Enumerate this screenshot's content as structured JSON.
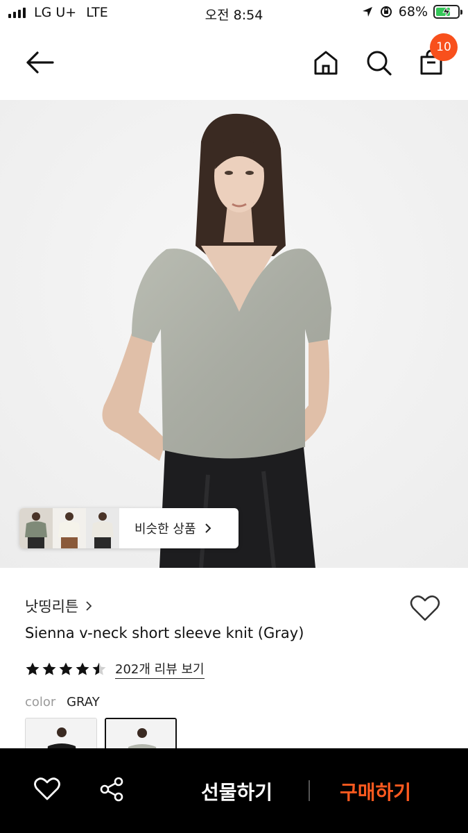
{
  "status_bar": {
    "carrier": "LG U+",
    "network": "LTE",
    "time": "오전 8:54",
    "battery": "68%",
    "battery_level": 0.68
  },
  "nav": {
    "cart_count": "10"
  },
  "similar": {
    "label": "비슷한 상품"
  },
  "product": {
    "brand": "낫띵리튼",
    "name": "Sienna v-neck short sleeve knit (Gray)",
    "rating_value": 4.5,
    "reviews_label": "202개 리뷰 보기",
    "color_key": "color",
    "color_value": "GRAY"
  },
  "bottom_bar": {
    "gift_label": "선물하기",
    "buy_label": "구매하기"
  },
  "colors": {
    "accent": "#f8501c",
    "buy_text": "#ff5a1f",
    "bar_bg": "#000000"
  },
  "icons": [
    "back-arrow-icon",
    "home-icon",
    "search-icon",
    "shopping-bag-icon",
    "chevron-right-icon",
    "heart-icon",
    "share-icon",
    "star-icon"
  ]
}
